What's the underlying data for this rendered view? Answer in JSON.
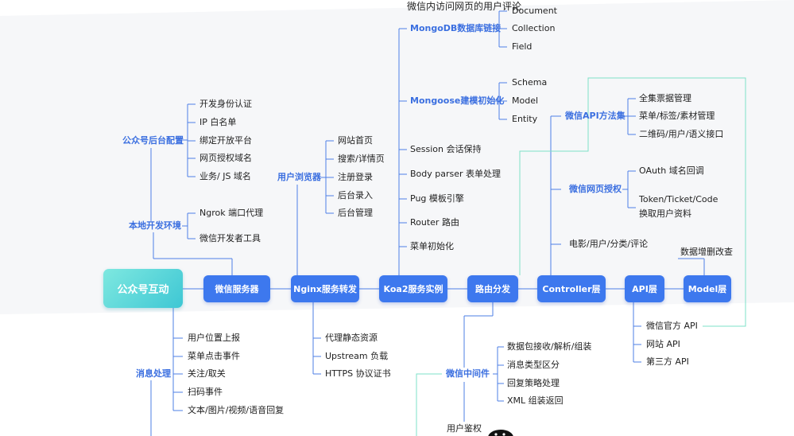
{
  "top_caption": "微信内访问网页的用户评论",
  "root": "公众号互动",
  "nodes": {
    "wx_server": "微信服务器",
    "nginx": "Nginx服务转发",
    "koa": "Koa2服务实例",
    "router": "路由分发",
    "controller": "Controller层",
    "api": "API层",
    "model": "Model层"
  },
  "groups": {
    "backend_config": "公众号后台配置",
    "local_dev": "本地开发环境",
    "user_browser": "用户浏览器",
    "mongodb": "MongoDB数据库链接",
    "mongoose": "Mongoose建模初始化",
    "wx_api_methods": "微信API方法集",
    "wx_web_auth": "微信网页授权",
    "message": "消息处理",
    "wx_middleware": "微信中间件"
  },
  "backend_config_items": [
    "开发身份认证",
    "IP 白名单",
    "绑定开放平台",
    "网页授权域名",
    "业务/ JS 域名"
  ],
  "local_dev_items": [
    "Ngrok 端口代理",
    "微信开发者工具"
  ],
  "browser_items": [
    "网站首页",
    "搜索/详情页",
    "注册登录",
    "后台录入",
    "后台管理"
  ],
  "mongodb_items": [
    "Document",
    "Collection",
    "Field"
  ],
  "mongoose_items": [
    "Schema",
    "Model",
    "Entity"
  ],
  "koa_items": [
    "Session 会话保持",
    "Body parser 表单处理",
    "Pug 模板引擎",
    "Router 路由",
    "菜单初始化"
  ],
  "api_method_items": [
    "全集票据管理",
    "菜单/标签/素材管理",
    "二维码/用户/语义接口"
  ],
  "web_auth_items": [
    "OAuth 域名回调",
    "Token/Ticket/Code",
    "换取用户资料"
  ],
  "controller_item": "电影/用户/分类/评论",
  "model_item": "数据增删改查",
  "api_items": [
    "微信官方 API",
    "网站 API",
    "第三方 API"
  ],
  "message_items": [
    "用户位置上报",
    "菜单点击事件",
    "关注/取关",
    "扫码事件",
    "文本/图片/视频/语音回复"
  ],
  "nginx_items": [
    "代理静态资源",
    "Upstream 负载",
    "HTTPS 协议证书"
  ],
  "middleware_items": [
    "数据包接收/解析/组装",
    "消息类型区分",
    "回复策略处理",
    "XML 组装返回"
  ],
  "user_auth": "用户鉴权",
  "colors": {
    "node": "#3d78ee",
    "root_start": "#7ee8e0",
    "root_end": "#3ec7d4",
    "line": "#4d7fe6",
    "green_line": "#7ee0c8",
    "group_text": "#3b6fe0"
  }
}
